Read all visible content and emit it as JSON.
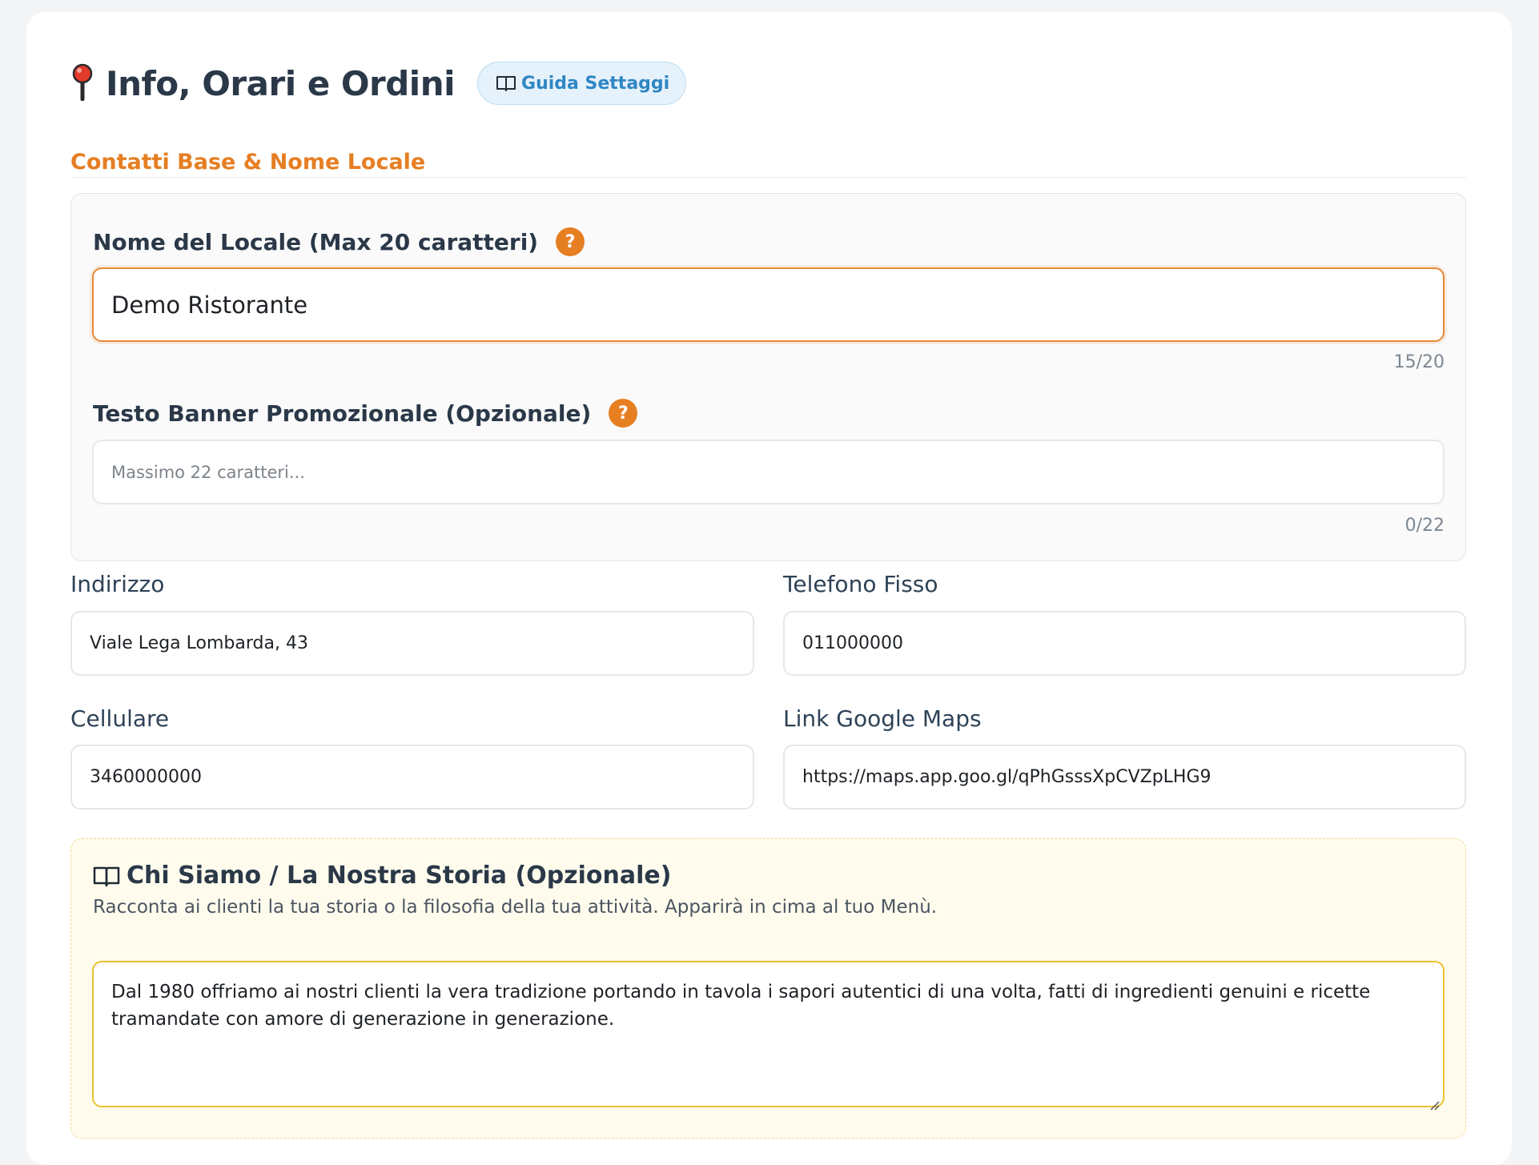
{
  "header": {
    "title": "Info, Orari e Ordini",
    "title_icon": "pin-icon",
    "guide_button_label": "Guida Settaggi",
    "guide_button_icon": "book-icon"
  },
  "section": {
    "title": "Contatti Base & Nome Locale"
  },
  "locale_name": {
    "label": "Nome del Locale (Max 20 caratteri)",
    "help": "?",
    "value": "Demo Ristorante",
    "counter": "15/20"
  },
  "banner": {
    "label": "Testo Banner Promozionale (Opzionale)",
    "help": "?",
    "placeholder": "Massimo 22 caratteri...",
    "value": "",
    "counter": "0/22"
  },
  "address": {
    "label": "Indirizzo",
    "value": "Viale Lega Lombarda, 43"
  },
  "landline": {
    "label": "Telefono Fisso",
    "value": "011000000"
  },
  "mobile": {
    "label": "Cellulare",
    "value": "3460000000"
  },
  "maps": {
    "label": "Link Google Maps",
    "value": "https://maps.app.goo.gl/qPhGsssXpCVZpLHG9"
  },
  "story": {
    "icon": "book-icon",
    "title": "Chi Siamo / La Nostra Storia (Opzionale)",
    "description": "Racconta ai clienti la tua storia o la filosofia della tua attività. Apparirà in cima al tuo Menù.",
    "value": "Dal 1980 offriamo ai nostri clienti la vera tradizione portando in tavola i sapori autentici di una volta, fatti di ingredienti genuini e ricette tramandate con amore di generazione in generazione."
  },
  "colors": {
    "accent": "#e67e22",
    "title_text": "#2a3848",
    "guide_button_bg": "#e6f2fb",
    "guide_button_text": "#2f86c4",
    "story_bg": "#fffcee",
    "story_border": "#ecc02e"
  }
}
